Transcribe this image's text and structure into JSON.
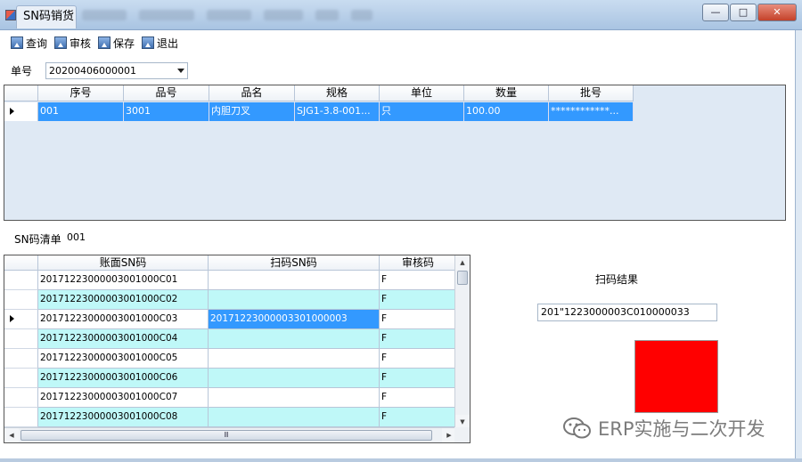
{
  "window": {
    "title": "SN码销货",
    "buttons": {
      "minimize": "—",
      "maximize": "□",
      "close": "✕"
    }
  },
  "toolbar": {
    "items": [
      {
        "label": "查询",
        "icon": "image-icon"
      },
      {
        "label": "审核",
        "icon": "image-icon"
      },
      {
        "label": "保存",
        "icon": "image-icon"
      },
      {
        "label": "退出",
        "icon": "image-icon"
      }
    ]
  },
  "order": {
    "label": "单号",
    "value": "20200406000001"
  },
  "grid1": {
    "columns": [
      "序号",
      "品号",
      "品名",
      "规格",
      "单位",
      "数量",
      "批号"
    ],
    "rows": [
      [
        "001",
        "3001",
        "内胆刀叉",
        "SJG1-3.8-001...",
        "只",
        "100.00",
        "************..."
      ]
    ]
  },
  "sn_list": {
    "label": "SN码清单",
    "value": "001"
  },
  "grid2": {
    "columns": [
      "账面SN码",
      "扫码SN码",
      "审核码"
    ],
    "rows": [
      [
        "20171223000003001000C01",
        "",
        "F"
      ],
      [
        "20171223000003001000C02",
        "",
        "F"
      ],
      [
        "20171223000003001000C03",
        "20171223000003301000003",
        "F"
      ],
      [
        "20171223000003001000C04",
        "",
        "F"
      ],
      [
        "20171223000003001000C05",
        "",
        "F"
      ],
      [
        "20171223000003001000C06",
        "",
        "F"
      ],
      [
        "20171223000003001000C07",
        "",
        "F"
      ],
      [
        "20171223000003001000C08",
        "",
        "F"
      ]
    ],
    "hscroll_grip": "Ⅲ"
  },
  "scan_result": {
    "label": "扫码结果",
    "value": "201\"1223000003C010000033",
    "status_color": "#ff0000"
  },
  "watermark": {
    "text": "ERP实施与二次开发"
  }
}
